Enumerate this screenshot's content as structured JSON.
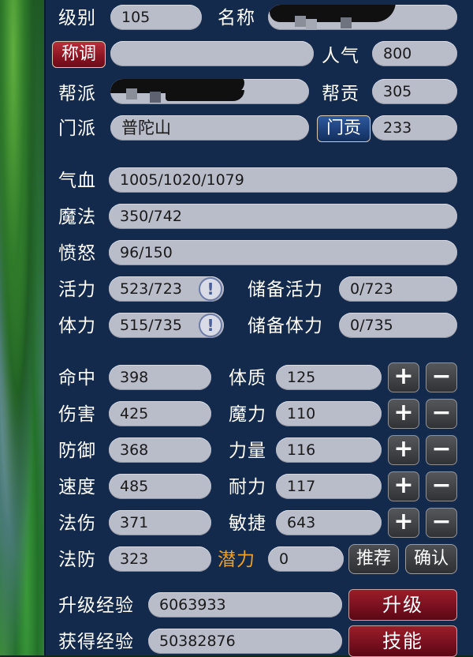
{
  "profile": {
    "level_label": "级别",
    "level_value": "105",
    "name_label": "名称",
    "title_button": "称调",
    "popularity_label": "人气",
    "popularity_value": "800",
    "faction_label": "帮派",
    "contribution_label": "帮贡",
    "contribution_value": "305",
    "sect_label": "门派",
    "sect_value": "普陀山",
    "sect_contrib_button": "门贡",
    "sect_contrib_value": "233"
  },
  "vitals": {
    "hp_label": "气血",
    "hp_value": "1005/1020/1079",
    "mp_label": "魔法",
    "mp_value": "350/742",
    "rage_label": "愤怒",
    "rage_value": "96/150",
    "vigor_label": "活力",
    "vigor_value": "523/723",
    "reserve_vigor_label": "储备活力",
    "reserve_vigor_value": "0/723",
    "stamina_label": "体力",
    "stamina_value": "515/735",
    "reserve_stamina_label": "储备体力",
    "reserve_stamina_value": "0/735",
    "info_icon": "!"
  },
  "combat": [
    {
      "label": "命中",
      "value": "398"
    },
    {
      "label": "伤害",
      "value": "425"
    },
    {
      "label": "防御",
      "value": "368"
    },
    {
      "label": "速度",
      "value": "485"
    },
    {
      "label": "法伤",
      "value": "371"
    },
    {
      "label": "法防",
      "value": "323"
    }
  ],
  "attributes": [
    {
      "label": "体质",
      "value": "125"
    },
    {
      "label": "魔力",
      "value": "110"
    },
    {
      "label": "力量",
      "value": "116"
    },
    {
      "label": "耐力",
      "value": "117"
    },
    {
      "label": "敏捷",
      "value": "643"
    }
  ],
  "buttons": {
    "plus": "+",
    "minus": "−",
    "potential_label": "潜力",
    "potential_value": "0",
    "recommend": "推荐",
    "confirm": "确认"
  },
  "experience": {
    "upgrade_label": "升级经验",
    "upgrade_value": "6063933",
    "upgrade_button": "升级",
    "gained_label": "获得经验",
    "gained_value": "50382876",
    "skills_button": "技能"
  },
  "colors": {
    "panel_bg": "#142a4c",
    "field_bg": "#b9bdca",
    "potential_label": "#f0a020"
  }
}
